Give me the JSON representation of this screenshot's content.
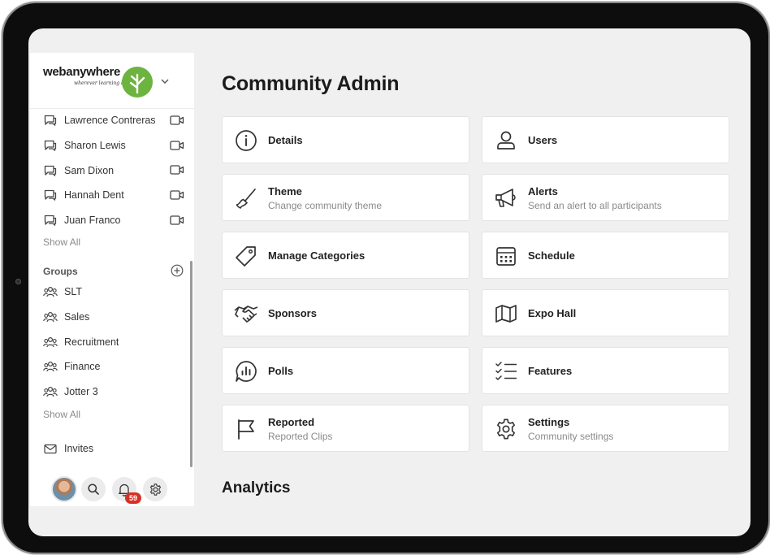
{
  "brand": {
    "name": "webanywhere",
    "tagline": "wherever learning begins",
    "accent_color": "#6db33f"
  },
  "sidebar": {
    "people": [
      {
        "name": "Lawrence Contreras",
        "icon": "chat-icon",
        "action_icon": "video-icon"
      },
      {
        "name": "Sharon Lewis",
        "icon": "chat-icon",
        "action_icon": "video-icon"
      },
      {
        "name": "Sam Dixon",
        "icon": "chat-icon",
        "action_icon": "video-icon"
      },
      {
        "name": "Hannah Dent",
        "icon": "chat-icon",
        "action_icon": "video-icon"
      },
      {
        "name": "Juan Franco",
        "icon": "chat-icon",
        "action_icon": "video-icon"
      }
    ],
    "people_show_all": "Show All",
    "groups_heading": "Groups",
    "groups": [
      {
        "name": "SLT",
        "icon": "group-icon"
      },
      {
        "name": "Sales",
        "icon": "group-icon"
      },
      {
        "name": "Recruitment",
        "icon": "group-icon"
      },
      {
        "name": "Finance",
        "icon": "group-icon"
      },
      {
        "name": "Jotter 3",
        "icon": "group-icon"
      }
    ],
    "groups_show_all": "Show All",
    "invites_label": "Invites",
    "notification_count": "59"
  },
  "main": {
    "title": "Community Admin",
    "cards": [
      {
        "title": "Details",
        "subtitle": "",
        "icon": "info-icon"
      },
      {
        "title": "Users",
        "subtitle": "",
        "icon": "user-icon"
      },
      {
        "title": "Theme",
        "subtitle": "Change community theme",
        "icon": "brush-icon"
      },
      {
        "title": "Alerts",
        "subtitle": "Send an alert to all participants",
        "icon": "megaphone-icon"
      },
      {
        "title": "Manage Categories",
        "subtitle": "",
        "icon": "tag-icon"
      },
      {
        "title": "Schedule",
        "subtitle": "",
        "icon": "calendar-icon"
      },
      {
        "title": "Sponsors",
        "subtitle": "",
        "icon": "handshake-icon"
      },
      {
        "title": "Expo Hall",
        "subtitle": "",
        "icon": "map-icon"
      },
      {
        "title": "Polls",
        "subtitle": "",
        "icon": "poll-icon"
      },
      {
        "title": "Features",
        "subtitle": "",
        "icon": "checklist-icon"
      },
      {
        "title": "Reported",
        "subtitle": "Reported Clips",
        "icon": "flag-icon"
      },
      {
        "title": "Settings",
        "subtitle": "Community settings",
        "icon": "gear-icon"
      }
    ],
    "analytics_title": "Analytics"
  }
}
